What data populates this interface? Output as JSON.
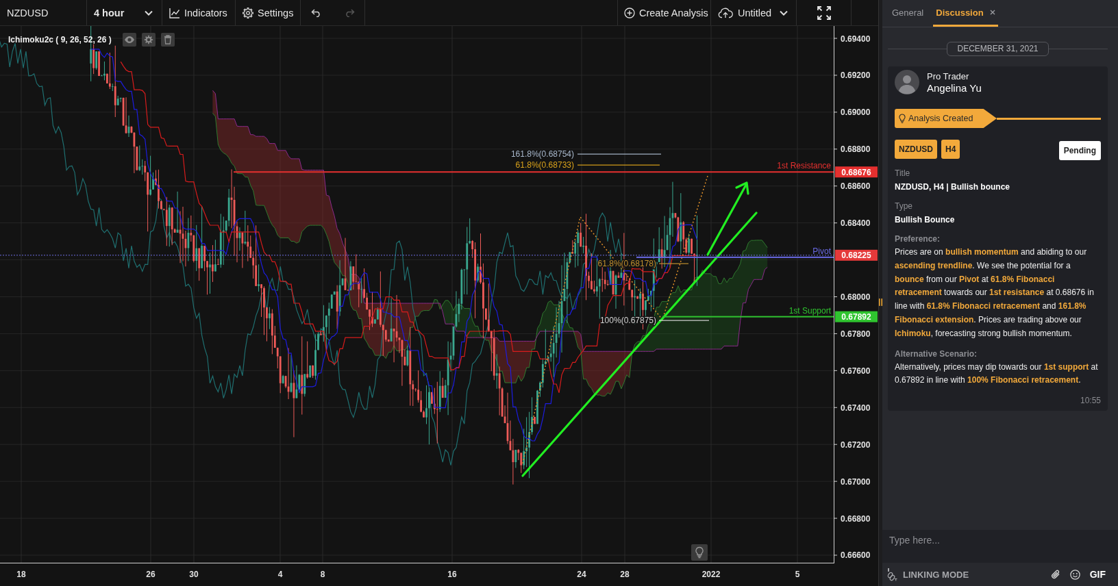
{
  "toolbar": {
    "symbol": "NZDUSD",
    "timeframe": "4 hour",
    "indicators": "Indicators",
    "settings": "Settings",
    "undo_enabled": true,
    "redo_enabled": false,
    "create": "Create Analysis",
    "layout": "Untitled"
  },
  "chart": {
    "indicator": "Ichimoku2c ( 9, 26, 52, 26 )",
    "price_ticks": [
      "0.69400",
      "0.69200",
      "0.69000",
      "0.68800",
      "0.68600",
      "0.68400",
      "0.68000",
      "0.67800",
      "0.67600",
      "0.67400",
      "0.67200",
      "0.67000",
      "0.66800",
      "0.66600"
    ],
    "time_labels": [
      "18",
      "26",
      "30",
      "4",
      "8",
      "16",
      "24",
      "28",
      "2022",
      "5"
    ],
    "levels": [
      {
        "kind": "resistance",
        "label": "1st Resistance",
        "tag": "0.68676",
        "color": "#e5302f"
      },
      {
        "kind": "pivot",
        "label": "Pivot",
        "color": "#6a6ae6"
      },
      {
        "kind": "support",
        "label": "1st Support",
        "tag": "0.67892",
        "color": "#2fc42f"
      }
    ],
    "last_price": "0.68225",
    "fib_labels": [
      {
        "text": "161.8%(0.68754)",
        "color": "#a8b8cc"
      },
      {
        "text": "61.8%(0.68733)",
        "color": "#d9a21b"
      },
      {
        "text": "61.8%(0.68178)",
        "color": "#c0902e"
      },
      {
        "text": "100%(0.67875)",
        "color": "#d4d4d4"
      }
    ]
  },
  "panel": {
    "tabs": [
      {
        "label": "General",
        "selected": false,
        "closable": false
      },
      {
        "label": "Discussion",
        "selected": true,
        "closable": true
      }
    ],
    "date": "DECEMBER 31, 2021",
    "post": {
      "role": "Pro Trader",
      "author": "Angelina Yu",
      "event": "Analysis Created",
      "tags": [
        "NZDUSD",
        "H4"
      ],
      "status": "Pending",
      "fields": [
        {
          "kind": "short",
          "label": "Title",
          "value": "NZDUSD, H4 | Bullish bounce"
        },
        {
          "kind": "short",
          "label": "Type",
          "value": "Bullish Bounce"
        },
        {
          "kind": "paragraph",
          "label": "Preference:",
          "value": "Prices are on **bullish momentum** and abiding to our **ascending trendline**. We see the potential for a **bounce** from our **Pivot** at **61.8% Fibonacci retracement** towards our **1st resistance** at 0.68676 in line with **61.8% Fibonacci retracement** and **161.8% Fibonacci extension**. Prices are trading above our **Ichimoku**, forecasting strong bullish momentum."
        },
        {
          "kind": "paragraph",
          "label": "Alternative Scenario:",
          "value": "Alternatively, prices may dip towards our **1st support** at 0.67892 in line with **100% Fibonacci retracement**."
        }
      ],
      "time": "10:55"
    },
    "composer": {
      "placeholder": "Type here...",
      "linking_mode": "LINKING MODE",
      "gif": "GIF"
    }
  }
}
